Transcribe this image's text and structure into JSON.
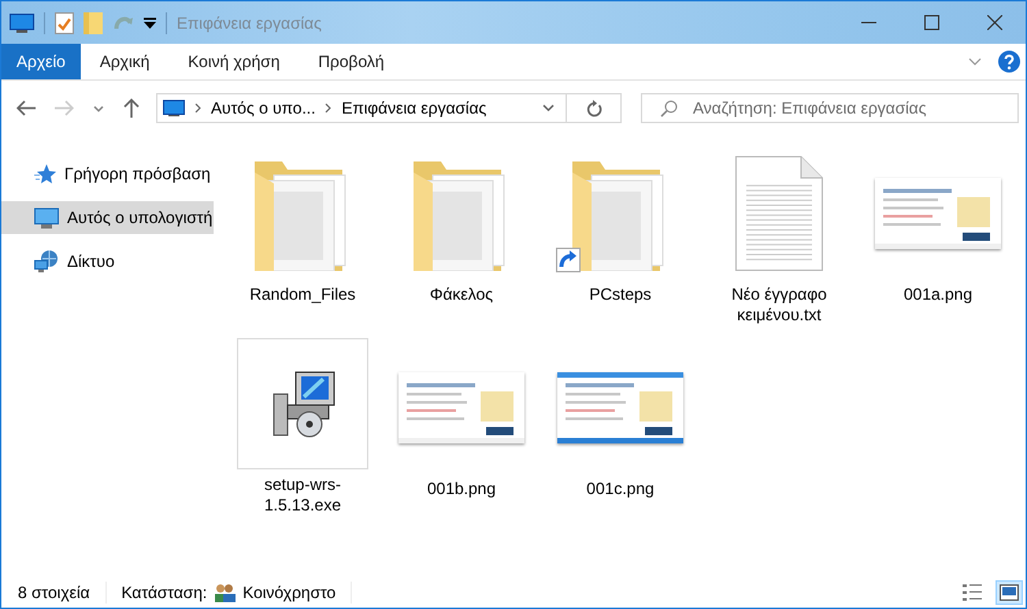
{
  "window": {
    "title": "Επιφάνεια εργασίας"
  },
  "ribbon_tabs": [
    {
      "label": "Αρχείο",
      "kind": "file"
    },
    {
      "label": "Αρχική",
      "kind": "tab"
    },
    {
      "label": "Κοινή χρήση",
      "kind": "tab"
    },
    {
      "label": "Προβολή",
      "kind": "tab"
    }
  ],
  "address": {
    "crumbs": [
      "Αυτός ο υπο...",
      "Επιφάνεια εργασίας"
    ]
  },
  "search": {
    "placeholder": "Αναζήτηση: Επιφάνεια εργασίας"
  },
  "sidebar": {
    "items": [
      {
        "label": "Γρήγορη πρόσβαση",
        "kind": "star",
        "selected": false
      },
      {
        "label": "Αυτός ο υπολογιστή",
        "kind": "computer",
        "selected": true
      },
      {
        "label": "Δίκτυο",
        "kind": "network",
        "selected": false
      }
    ]
  },
  "files": [
    {
      "name": "Random_Files",
      "kind": "folder",
      "shortcut": false,
      "focused": false
    },
    {
      "name": "Φάκελος",
      "kind": "folder",
      "shortcut": false,
      "focused": false
    },
    {
      "name": "PCsteps",
      "kind": "folder",
      "shortcut": true,
      "focused": false
    },
    {
      "name": "Νέο έγγραφο κειμένου.txt",
      "kind": "text",
      "shortcut": false,
      "focused": false
    },
    {
      "name": "001a.png",
      "shortcut": false,
      "focused": false
    },
    {
      "name": "setup-wrs-1.5.13.exe",
      "kind": "exe",
      "shortcut": false,
      "focused": true
    },
    {
      "name": "001b.png",
      "shortcut": false,
      "focused": false
    },
    {
      "name": "001c.png",
      "shortcut": false,
      "focused": false
    }
  ],
  "status_bar": {
    "count": "8 στοιχεία",
    "state_label": "Κατάσταση:",
    "state_value": "Κοινόχρηστο",
    "views": [
      {
        "kind": "details",
        "selected": false
      },
      {
        "kind": "large_icons",
        "selected": true
      }
    ]
  }
}
